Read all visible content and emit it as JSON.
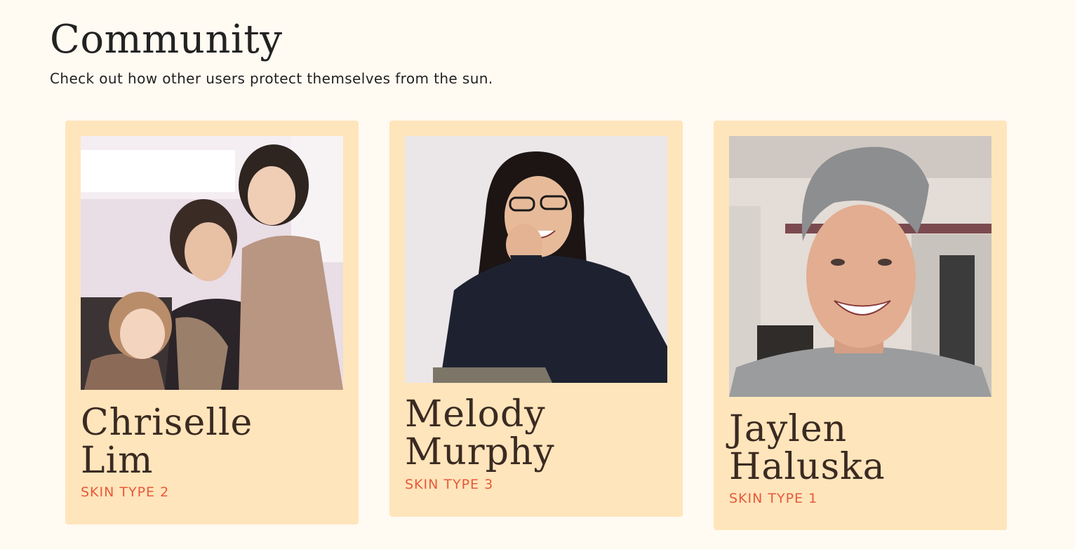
{
  "header": {
    "title": "Community",
    "subtitle": "Check out how other users protect themselves from the sun."
  },
  "cards": [
    {
      "first_name": "Chriselle",
      "last_name": "Lim",
      "skin_type": "SKIN TYPE 2"
    },
    {
      "first_name": "Melody",
      "last_name": "Murphy",
      "skin_type": "SKIN TYPE 3"
    },
    {
      "first_name": "Jaylen",
      "last_name": "Haluska",
      "skin_type": "SKIN TYPE 1"
    }
  ],
  "colors": {
    "page_background": "#fffaf2",
    "card_background": "#ffe5bb",
    "name_text": "#3a2a22",
    "skin_type_accent": "#e8593a"
  }
}
